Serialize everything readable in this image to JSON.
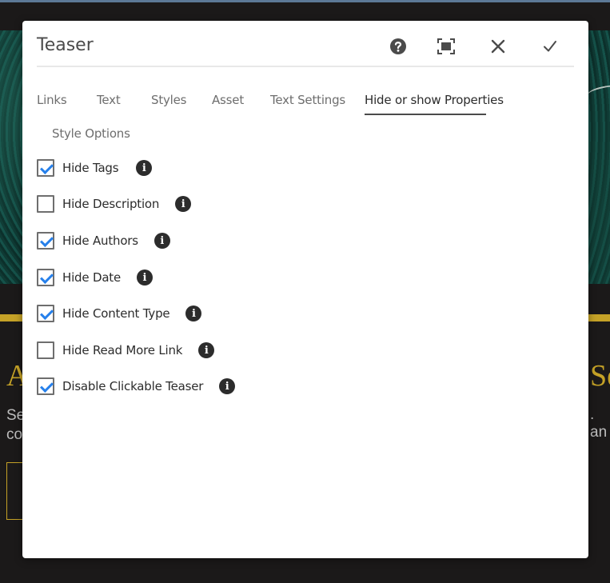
{
  "background": {
    "heading_left": "A",
    "heading_right": "Se",
    "text_left_line1": "Se",
    "text_left_line2": "co",
    "text_right": ". an"
  },
  "dialog": {
    "title": "Teaser",
    "header_icons": [
      "help-icon",
      "fullscreen-icon",
      "close-icon",
      "checkmark-icon"
    ],
    "tabs": [
      {
        "label": "Links",
        "active": false
      },
      {
        "label": "Text",
        "active": false
      },
      {
        "label": "Styles",
        "active": false
      },
      {
        "label": "Asset",
        "active": false
      },
      {
        "label": "Text Settings",
        "active": false
      },
      {
        "label": "Hide or show Properties",
        "active": true
      },
      {
        "label": "Style Options",
        "active": false
      }
    ],
    "options": [
      {
        "label": "Hide Tags",
        "checked": true
      },
      {
        "label": "Hide Description",
        "checked": false
      },
      {
        "label": "Hide Authors",
        "checked": true
      },
      {
        "label": "Hide Date",
        "checked": true
      },
      {
        "label": "Hide Content Type",
        "checked": true
      },
      {
        "label": "Hide Read More Link",
        "checked": false
      },
      {
        "label": "Disable Clickable Teaser",
        "checked": true
      }
    ],
    "colors": {
      "checkmark": "#2680eb",
      "accent_gold": "#c5a227"
    }
  }
}
